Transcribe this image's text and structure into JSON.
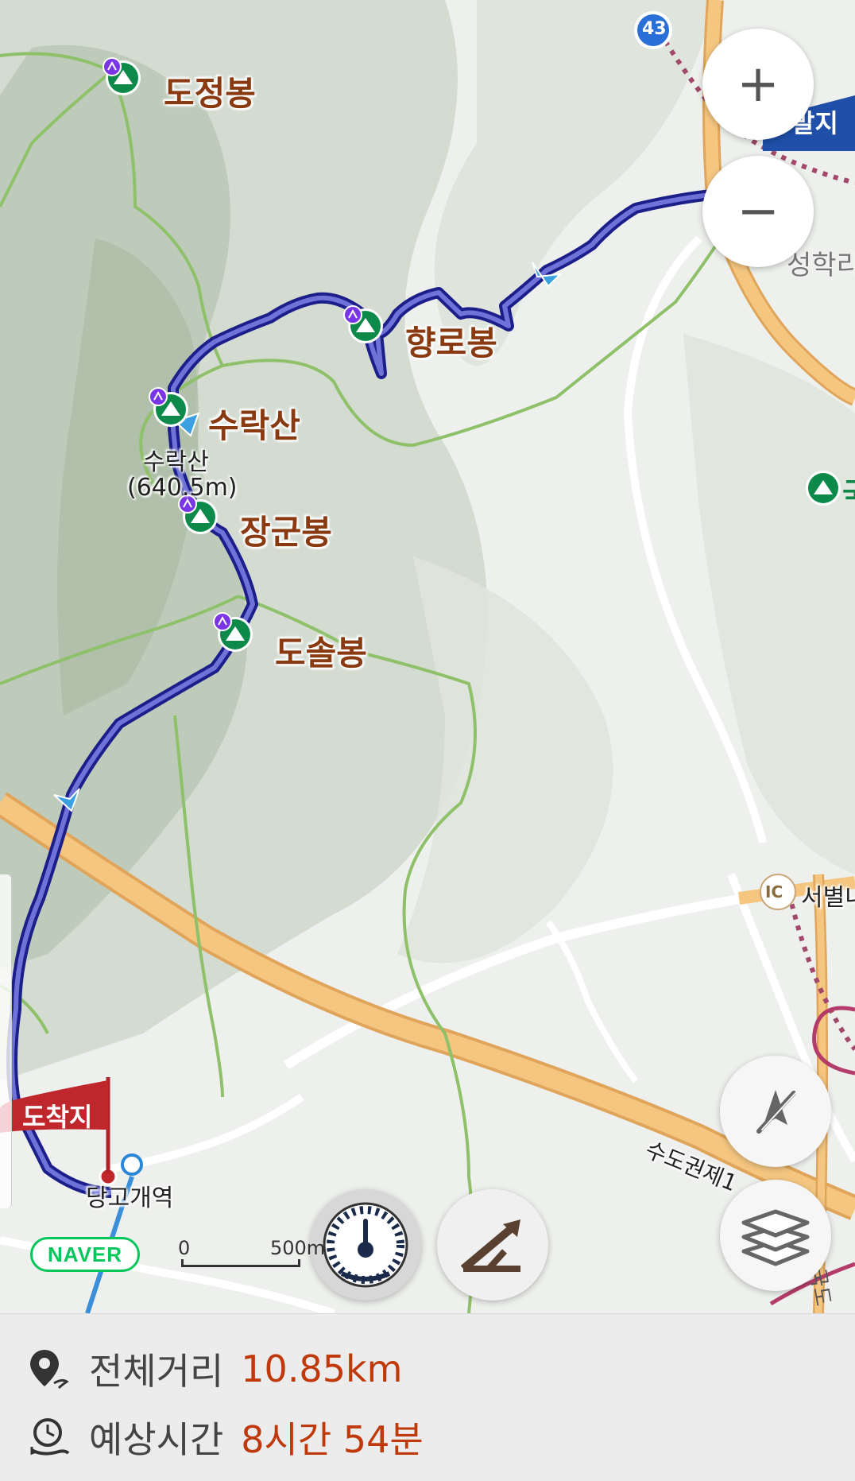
{
  "map": {
    "route_badge": "43",
    "dest_partial_label": "발지",
    "seonghak_partial": "성학리",
    "interchange": {
      "badge": "IC",
      "label": "서별내"
    },
    "highway_label": "수도권제1",
    "peak_summit_label_line1": "수락산",
    "peak_summit_label_line2": "(640.5m)",
    "station_label": "당고개역",
    "right_edge_partial": "국",
    "bottom_right_partial": "국도",
    "peaks": [
      {
        "name": "도정봉"
      },
      {
        "name": "향로봉"
      },
      {
        "name": "수락산"
      },
      {
        "name": "장군봉"
      },
      {
        "name": "도솔봉"
      }
    ],
    "destination_flag": "도착지",
    "naver_logo": "NAVER",
    "scale": {
      "zero": "0",
      "max": "500m"
    },
    "colors": {
      "route": "#3c3fb0",
      "trail": "#8fc06a",
      "highway": "#f1b96a",
      "flag": "#c0272d",
      "peak_marker": "#0d8a4a"
    }
  },
  "controls": {
    "zoom_in": "+",
    "zoom_out": "−",
    "gyro_icon": "compass-off-icon",
    "layers_icon": "layers-icon",
    "speedometer_icon": "speedometer-icon",
    "elevation_icon": "elevation-profile-icon"
  },
  "info": {
    "distance_label": "전체거리",
    "distance_value": "10.85km",
    "time_label": "예상시간",
    "time_value": "8시간 54분"
  }
}
